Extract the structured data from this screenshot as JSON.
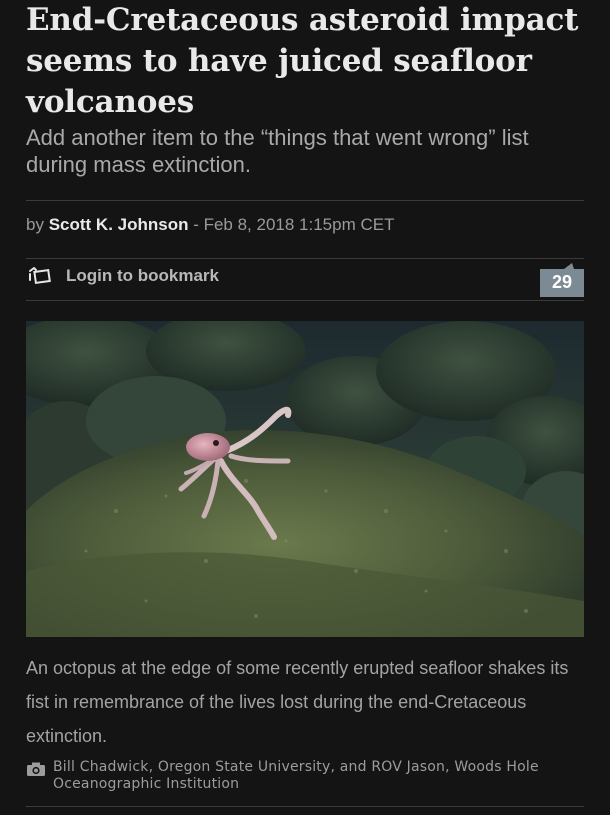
{
  "article": {
    "headline": "End-Cretaceous asteroid impact seems to have juiced seafloor volcanoes",
    "dek": "Add another item to the “things that went wrong” list during mass extinction.",
    "byline": {
      "prefix": "by ",
      "author": "Scott K. Johnson",
      "date": " - Feb 8, 2018 1:15pm CET"
    },
    "bookmark": {
      "label": "Login to bookmark",
      "icon": "bookmark-icon"
    },
    "comments": {
      "count": "29",
      "color": "#7c8a93"
    },
    "image": {
      "caption": "An octopus at the edge of some recently erupted seafloor shakes its fist in remembrance of the lives lost during the end-Cretaceous extinction.",
      "credit": "Bill Chadwick, Oregon State University, and ROV Jason, Woods Hole Oceanographic Institution",
      "credit_icon": "camera-icon"
    }
  },
  "colors": {
    "background": "#141414",
    "headline": "#e9e9e9",
    "dek": "#a9a9a9",
    "divider": "#3a3a3a"
  }
}
